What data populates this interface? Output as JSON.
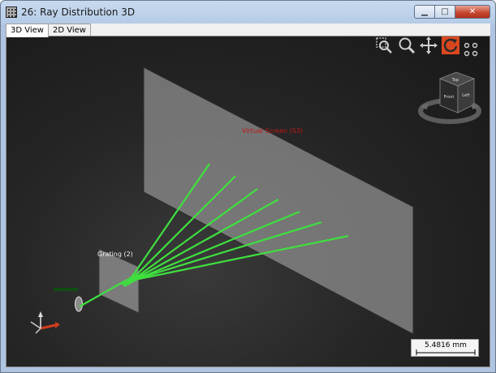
{
  "window": {
    "title": "26: Ray Distribution 3D",
    "minimize_glyph": "▁",
    "maximize_glyph": "□",
    "close_glyph": "✕"
  },
  "tabs": [
    {
      "label": "3D View",
      "active": true
    },
    {
      "label": "2D View",
      "active": false
    }
  ],
  "toolbar": {
    "icons": [
      "zoom-region-icon",
      "zoom-icon",
      "pan-icon",
      "rotate-icon",
      "fit-views-icon"
    ],
    "active": "rotate-icon"
  },
  "scene": {
    "screen_label": "Virtual Screen (S3)",
    "grating_label": "Grating (2)",
    "ray_color": "#3fe03f",
    "screen_color": "#8a8a8a",
    "label_color": "#c01818"
  },
  "view_cube": {
    "faces": [
      "Top",
      "Front",
      "Left"
    ]
  },
  "scale_bar": {
    "label": "5.4816 mm"
  }
}
